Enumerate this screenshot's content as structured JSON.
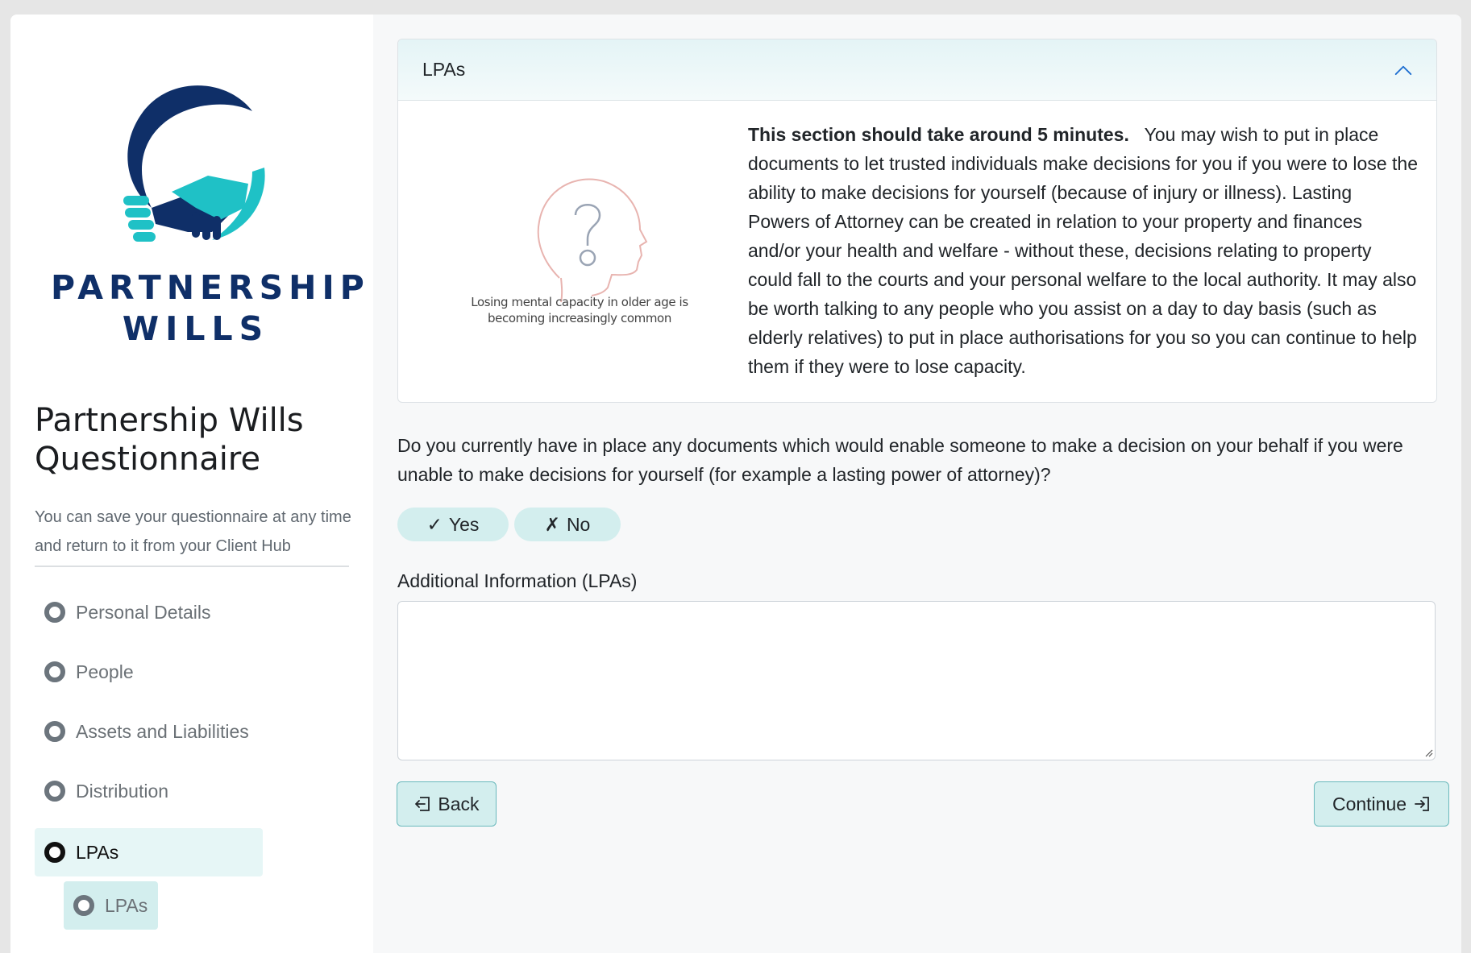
{
  "brand": {
    "logo_line1": "PARTNERSHIP",
    "logo_line2": "WILLS",
    "primary_color": "#0f2f68",
    "accent_color": "#1fc1c6"
  },
  "sidebar": {
    "title_line1": "Partnership Wills",
    "title_line2": "Questionnaire",
    "subtitle": "You can save your questionnaire at any time and return to it from your Client Hub",
    "items": [
      {
        "label": "Personal Details",
        "state": "incomplete"
      },
      {
        "label": "People",
        "state": "incomplete"
      },
      {
        "label": "Assets and Liabilities",
        "state": "incomplete"
      },
      {
        "label": "Distribution",
        "state": "incomplete"
      },
      {
        "label": "LPAs",
        "state": "active"
      }
    ],
    "sub_items": [
      {
        "label": "LPAs",
        "state": "active"
      }
    ]
  },
  "section": {
    "header": "LPAs",
    "toggle_icon": "chevron-up-icon",
    "illustration_caption": "Losing mental capacity in older age is becoming increasingly common",
    "intro_bold": "This section should take around 5 minutes.",
    "intro_text": "You may wish to put in place documents to let trusted individuals make decisions for you if you were to lose the ability to make decisions for yourself (because of injury or illness). Lasting Powers of Attorney can be created in relation to your property and finances and/or your health and welfare - without these, decisions relating to property could fall to the courts and your personal welfare to the local authority. It may also be worth talking to any people who you assist on a day to day basis (such as elderly relatives) to put in place authorisations for you so you can continue to help them if they were to lose capacity."
  },
  "question": {
    "text": "Do you currently have in place any documents which would enable someone to make a decision on your behalf if you were unable to make decisions for yourself (for example a lasting power of attorney)?",
    "yes_mark": "✓",
    "yes_label": "Yes",
    "no_mark": "✗",
    "no_label": "No"
  },
  "additional": {
    "label": "Additional Information (LPAs)",
    "value": ""
  },
  "actions": {
    "back_label": "Back",
    "continue_label": "Continue"
  }
}
